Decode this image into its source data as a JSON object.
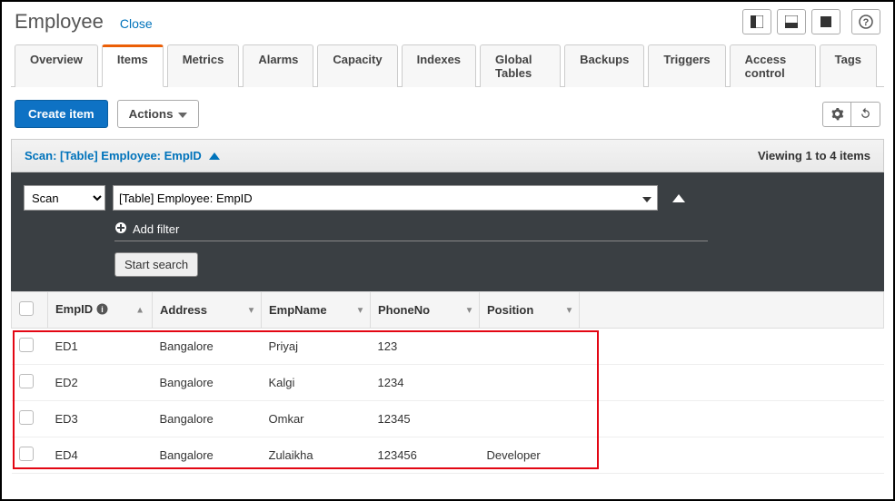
{
  "header": {
    "title": "Employee",
    "close_label": "Close"
  },
  "tabs": [
    "Overview",
    "Items",
    "Metrics",
    "Alarms",
    "Capacity",
    "Indexes",
    "Global Tables",
    "Backups",
    "Triggers",
    "Access control",
    "Tags"
  ],
  "active_tab_index": 1,
  "actions": {
    "create_label": "Create item",
    "actions_label": "Actions"
  },
  "scan_bar": {
    "label": "Scan: [Table] Employee: EmpID",
    "viewing": "Viewing 1 to 4 items"
  },
  "dark": {
    "scan_select": "Scan",
    "table_select": "[Table] Employee: EmpID",
    "add_filter": "Add filter",
    "start_search": "Start search"
  },
  "table": {
    "columns": [
      "EmpID",
      "Address",
      "EmpName",
      "PhoneNo",
      "Position"
    ],
    "rows": [
      {
        "EmpID": "ED1",
        "Address": "Bangalore",
        "EmpName": "Priyaj",
        "PhoneNo": "123",
        "Position": ""
      },
      {
        "EmpID": "ED2",
        "Address": "Bangalore",
        "EmpName": "Kalgi",
        "PhoneNo": "1234",
        "Position": ""
      },
      {
        "EmpID": "ED3",
        "Address": "Bangalore",
        "EmpName": "Omkar",
        "PhoneNo": "12345",
        "Position": ""
      },
      {
        "EmpID": "ED4",
        "Address": "Bangalore",
        "EmpName": "Zulaikha",
        "PhoneNo": "123456",
        "Position": "Developer"
      }
    ]
  }
}
